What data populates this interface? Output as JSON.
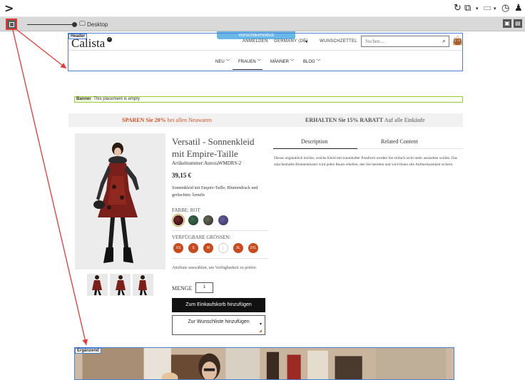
{
  "editor": {
    "device_label": "Desktop",
    "preview_mode_label": "Vorschaumodus",
    "header_tag": "Header",
    "banner_tag": "Banner",
    "banner_message": "This placement is empty",
    "ergaenzend_tag": "Ergänzend"
  },
  "site": {
    "logo": "Calista",
    "top_links": [
      "ANMELDEN",
      "GERMANY (DE)",
      "WUNSCHZETTEL"
    ],
    "search_placeholder": "Suchen....",
    "nav": [
      "NEU",
      "FRAUEN",
      "MÄNNER",
      "BLOG"
    ]
  },
  "promo": {
    "left_bold": "SPAREN Sie 20%",
    "left_rest": " bei allen Neuwaren",
    "right_bold": "ERHALTEN Sie 15% RABATT",
    "right_rest": " Auf alle Einkäufe"
  },
  "product": {
    "title": "Versatil - Sonnenkleid mit Empire-Taille",
    "article": "Artikelnummer:AuroraWMDRS-2",
    "price": "39,15 €",
    "short_desc": "Sonnenkleid mit Empire-Taille, Blumendruck und gerüschten Ärmeln",
    "color_label": "FARBE: ROT",
    "sizes_label": "VERFÜGBARE GRÖSSEN:",
    "sizes": [
      "XS",
      "S",
      "M",
      "L",
      "XL",
      "2XL"
    ],
    "attr_note": "Attribute auswählen, um Verfügbarkeit zu prüfen",
    "qty_label": "MENGE",
    "qty_value": "1",
    "add_to_cart": "Zum Einkaufskorb hinzufügen",
    "add_to_wishlist": "Zur Wunschliste hinzufügen"
  },
  "tabs": {
    "items": [
      "Description",
      "Related Content"
    ],
    "description": "Dieses unglaublich leichte, weiche Kleid mit traumhafter Paraform werden Sie einfach nicht mehr ausziehen wollen. Das märchenhafte Blumenmuster wird jeden Raum erhellen, den Sie betreten und wird Ihnen alle Aufmerksamkeit sichern."
  },
  "colors": {
    "accent_red": "#e53935",
    "preview_blue": "#6ab8e8",
    "placement_blue": "#4a7fd6",
    "banner_green": "#9ccc37",
    "promo_orange": "#d05424",
    "size_orange": "#c94a1d"
  }
}
